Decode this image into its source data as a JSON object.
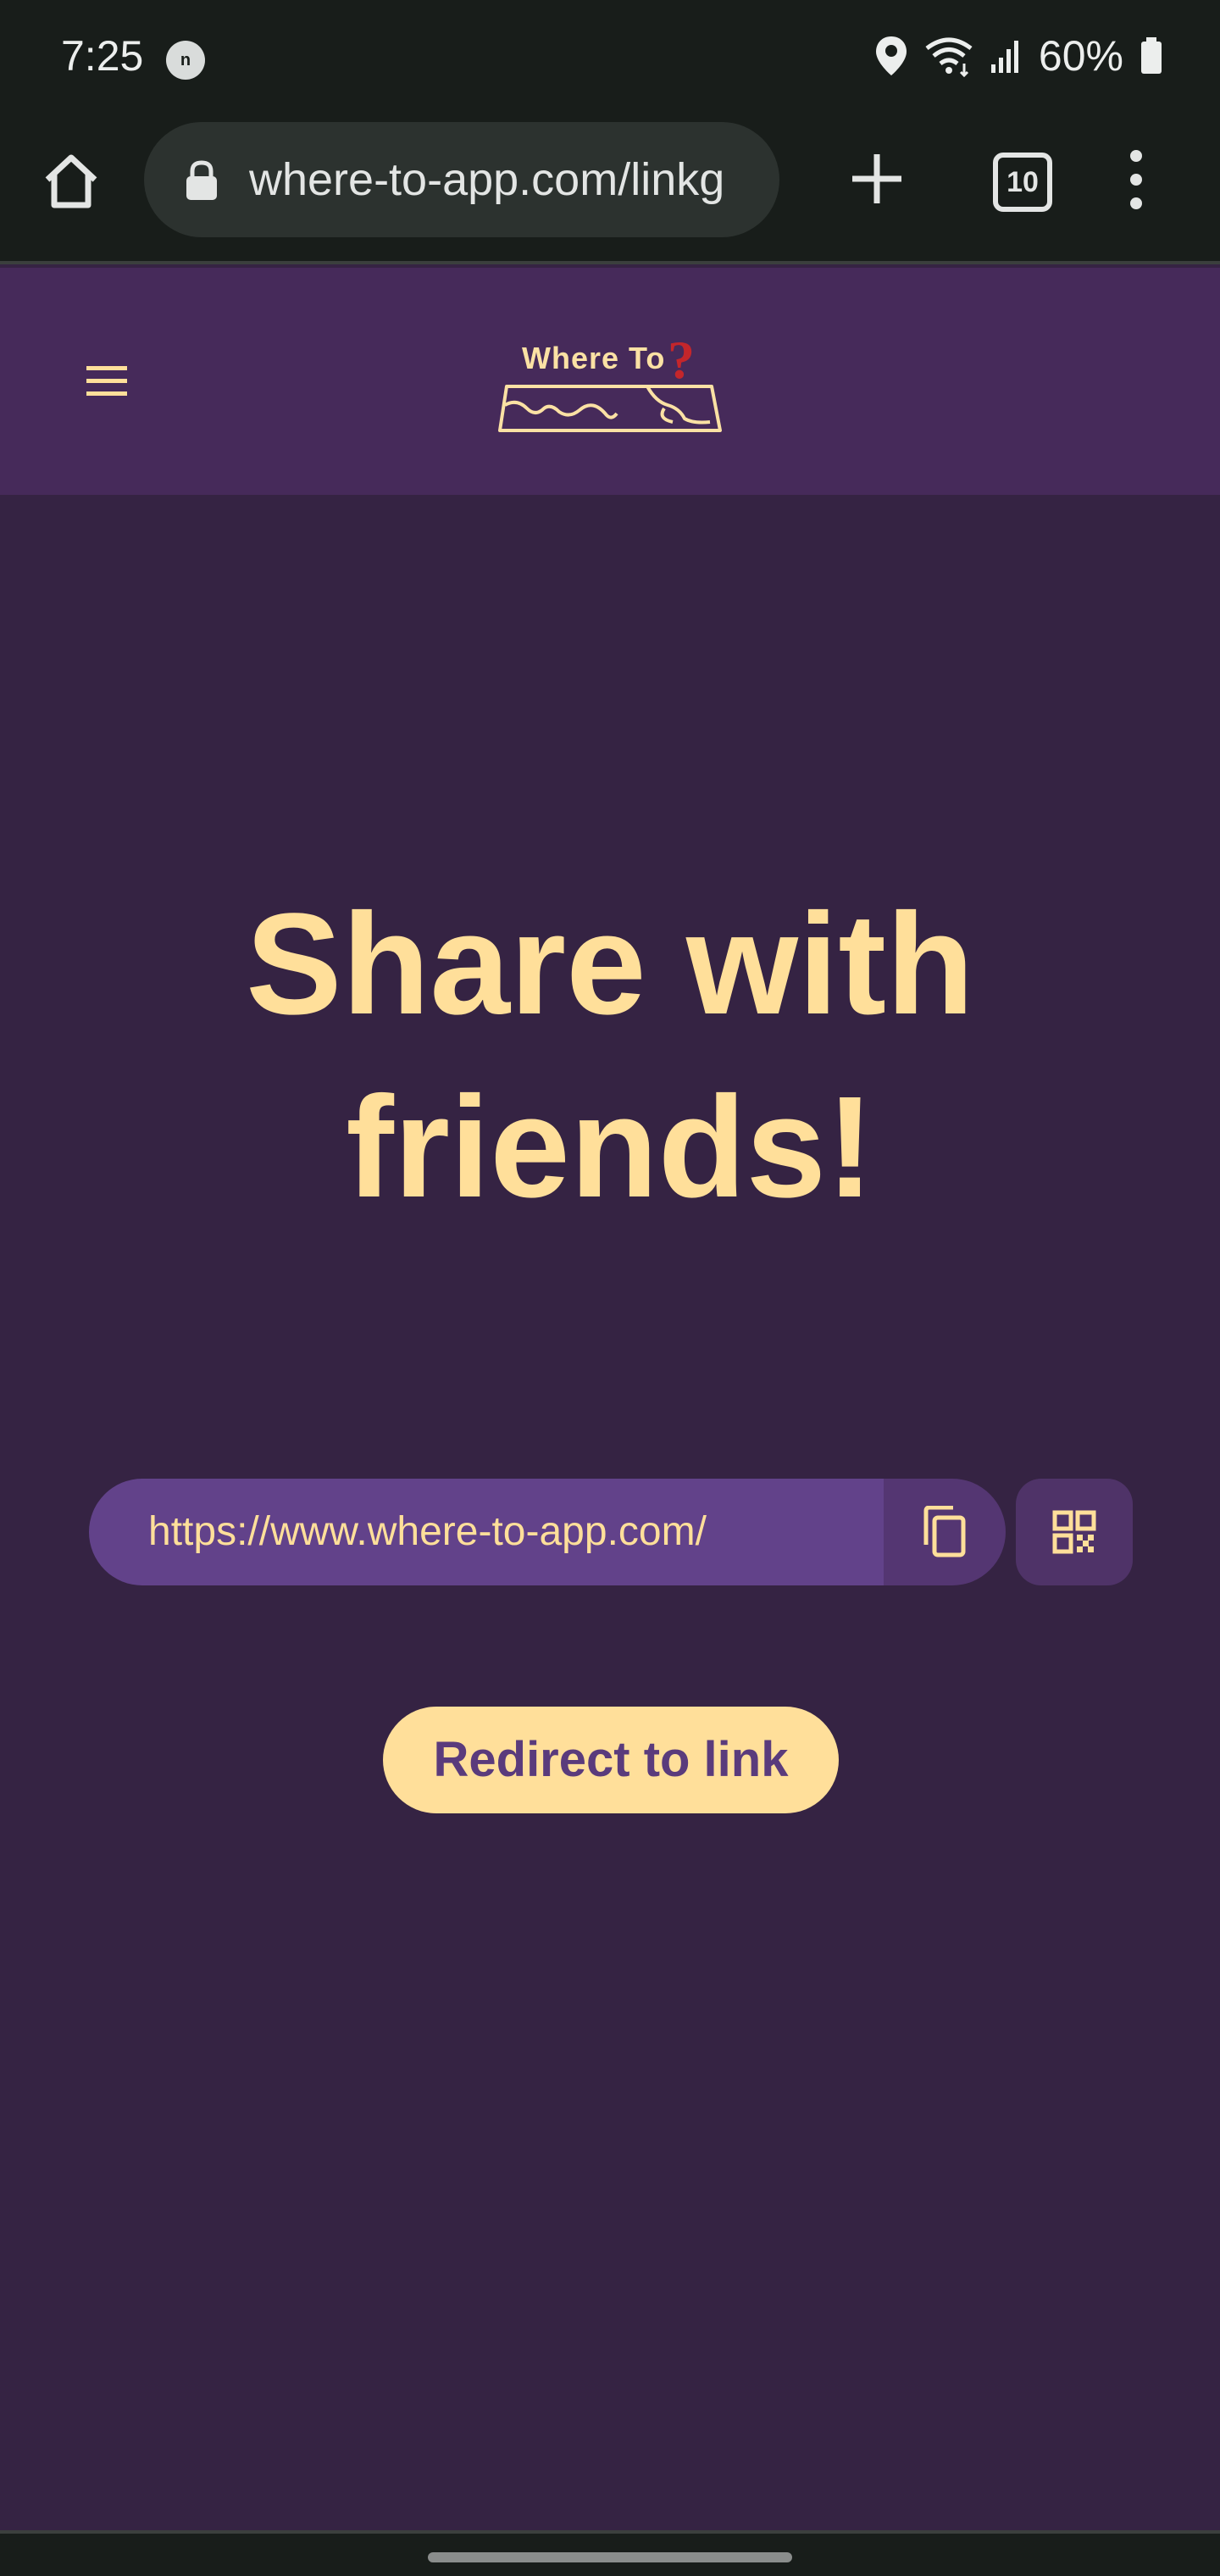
{
  "status_bar": {
    "time": "7:25",
    "notification_letter": "n",
    "battery_percent": "60%",
    "icons": [
      "location-icon",
      "wifi-icon",
      "signal-icon",
      "battery-icon"
    ]
  },
  "browser": {
    "url": "where-to-app.com/linkg",
    "tab_count": "10"
  },
  "site": {
    "logo_text": "Where To",
    "logo_mark": "?",
    "colors": {
      "header_bg": "#462a5a",
      "page_bg": "#352343",
      "accent": "#ffdf9a",
      "field_bg": "#62428a",
      "logo_question": "#c4262b"
    }
  },
  "main": {
    "headline_line1": "Share with",
    "headline_line2": "friends!",
    "share_link": "https://www.where-to-app.com/",
    "redirect_label": "Redirect to link"
  }
}
